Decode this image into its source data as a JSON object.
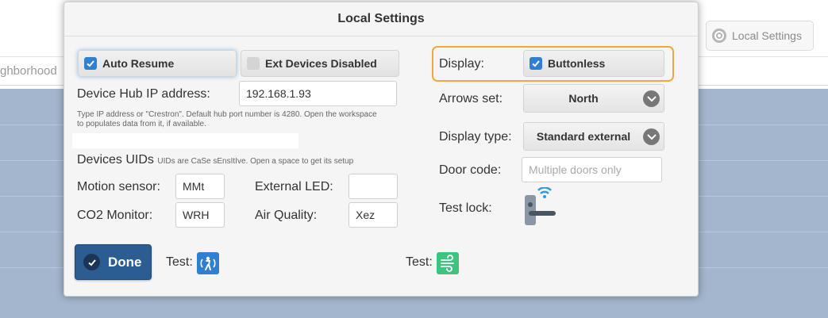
{
  "background": {
    "subbar_text": "ghborhood",
    "local_settings_button": "Local Settings",
    "colors": {
      "main_panel": "#a3b6cd"
    }
  },
  "modal": {
    "title": "Local Settings",
    "auto_resume": {
      "label": "Auto Resume",
      "checked": true
    },
    "ext_devices_disabled": {
      "label": "Ext Devices Disabled",
      "checked": false
    },
    "hub_ip": {
      "label": "Device Hub IP address:",
      "value": "192.168.1.93",
      "help": "Type IP address or \"Crestron\". Default hub port number is 4280. Open the workspace to populates data from it, if available."
    },
    "devices_uids": {
      "title": "Devices UIDs",
      "note": "UIDs are CaSe sEnsItIve. Open a space to get its setup",
      "motion_sensor": {
        "label": "Motion sensor:",
        "value": "MMt"
      },
      "co2_monitor": {
        "label": "CO2 Monitor:",
        "value": "WRH"
      },
      "external_led": {
        "label": "External LED:",
        "value": ""
      },
      "air_quality": {
        "label": "Air Quality:",
        "value": "Xez"
      }
    },
    "display": {
      "label": "Display:",
      "option_label": "Buttonless",
      "checked": true
    },
    "arrows_set": {
      "label": "Arrows set:",
      "value": "North"
    },
    "display_type": {
      "label": "Display type:",
      "value": "Standard external"
    },
    "door_code": {
      "label": "Door code:",
      "value": "",
      "placeholder": "Multiple doors only"
    },
    "test_lock": {
      "label": "Test lock:",
      "icon": "smart-lock-icon"
    },
    "done_button": "Done",
    "test_motion": {
      "label": "Test:",
      "icon": "motion-sensor-icon",
      "color": "#2f7fd3"
    },
    "test_air": {
      "label": "Test:",
      "icon": "air-quality-icon",
      "color": "#3fc47f"
    },
    "colors": {
      "accent": "#2f7fd3",
      "highlight": "#f0a93a",
      "done": "#2b5d92"
    }
  }
}
